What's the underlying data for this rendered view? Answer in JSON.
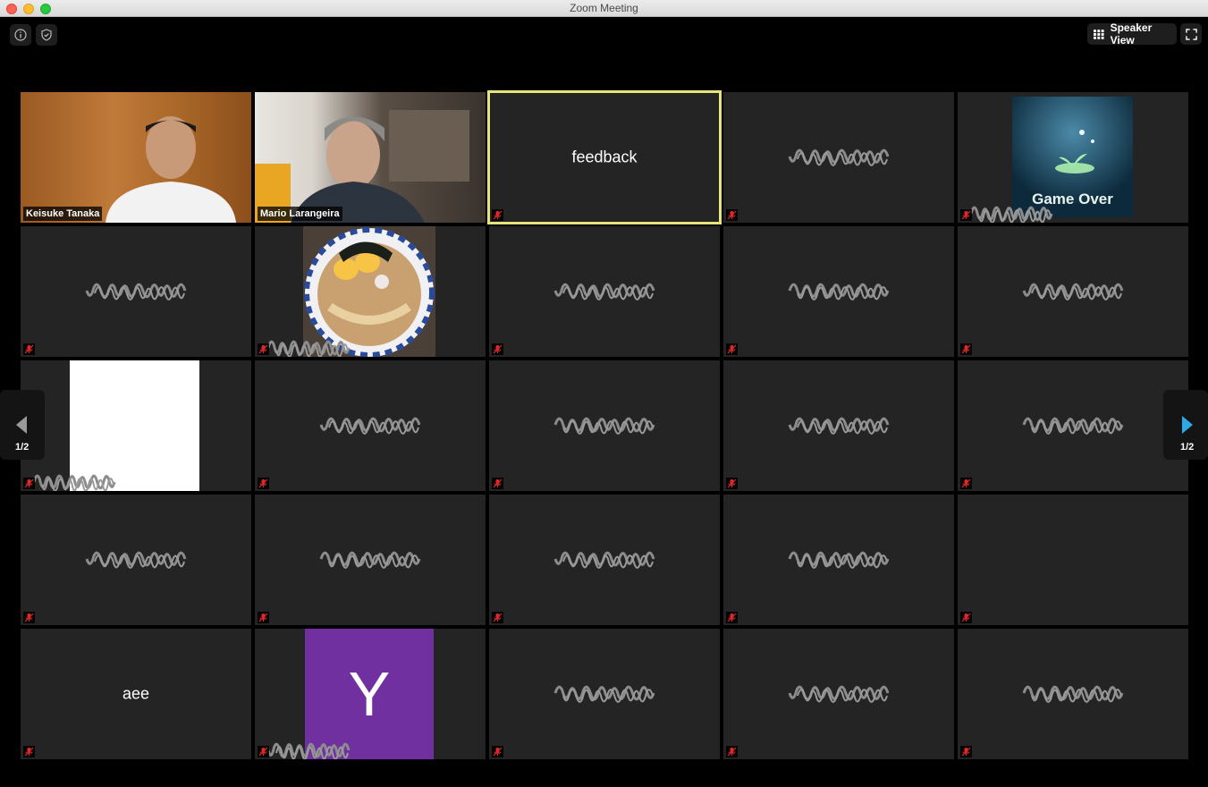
{
  "window": {
    "title": "Zoom Meeting"
  },
  "toolbar": {
    "info_icon": "info-icon",
    "security_icon": "shield-icon",
    "speaker_view_label": "Speaker View",
    "fullscreen_icon": "fullscreen-icon"
  },
  "pagination": {
    "prev_page": "1/2",
    "next_page": "1/2"
  },
  "participants": [
    {
      "name": "Keisuke Tanaka",
      "video": "camera"
    },
    {
      "name": "Mario Larangeira",
      "video": "camera"
    },
    {
      "name": "feedback",
      "video": "off",
      "active_speaker": true
    },
    {
      "name": "",
      "video": "off",
      "name_obscured": true
    },
    {
      "name": "",
      "video": "image",
      "image_text": "Game Over",
      "name_obscured": true
    },
    {
      "name": "",
      "video": "off",
      "name_obscured": true
    },
    {
      "name": "",
      "video": "image",
      "image_subject": "ramen",
      "name_obscured": true
    },
    {
      "name": "",
      "video": "off",
      "name_obscured": true
    },
    {
      "name": "",
      "video": "off",
      "name_obscured": true
    },
    {
      "name": "",
      "video": "off",
      "name_obscured": true
    },
    {
      "name": "",
      "video": "image",
      "image_subject": "white",
      "name_obscured": true
    },
    {
      "name": "",
      "video": "off",
      "name_obscured": true
    },
    {
      "name": "",
      "video": "off",
      "name_obscured": true
    },
    {
      "name": "",
      "video": "off",
      "name_obscured": true
    },
    {
      "name": "",
      "video": "off",
      "name_obscured": true
    },
    {
      "name": "",
      "video": "off",
      "name_obscured": true
    },
    {
      "name": "",
      "video": "off",
      "name_obscured": true
    },
    {
      "name": "",
      "video": "off",
      "name_obscured": true
    },
    {
      "name": "",
      "video": "off",
      "name_obscured": true
    },
    {
      "name": "",
      "video": "off"
    },
    {
      "name": "aee",
      "video": "off"
    },
    {
      "name": "",
      "video": "avatar",
      "avatar_letter": "Y",
      "avatar_color": "#7030a0",
      "name_obscured": true
    },
    {
      "name": "",
      "video": "off",
      "name_obscured": true
    },
    {
      "name": "",
      "video": "off",
      "name_obscured": true
    },
    {
      "name": "",
      "video": "off",
      "name_obscured": true
    }
  ],
  "colors": {
    "tile_background": "#242424",
    "active_speaker_border": "#e6e47a",
    "muted_icon": "#e02828",
    "next_arrow": "#2ea8e6"
  }
}
